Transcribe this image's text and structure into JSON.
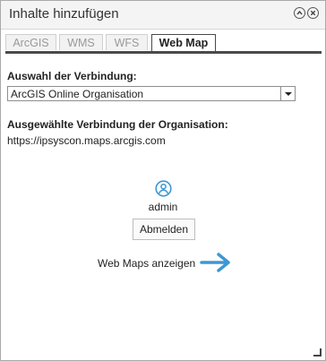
{
  "window": {
    "title": "Inhalte hinzufügen"
  },
  "tabs": [
    {
      "label": "ArcGIS"
    },
    {
      "label": "WMS"
    },
    {
      "label": "WFS"
    },
    {
      "label": "Web Map"
    }
  ],
  "connection": {
    "label": "Auswahl der Verbindung:",
    "selected": "ArcGIS Online Organisation"
  },
  "org": {
    "label": "Ausgewählte Verbindung der Organisation:",
    "url": "https://ipsyscon.maps.arcgis.com"
  },
  "user": {
    "name": "admin",
    "logout_label": "Abmelden"
  },
  "webmaps": {
    "link_label": "Web Maps anzeigen"
  },
  "colors": {
    "accent": "#3d97d3"
  }
}
